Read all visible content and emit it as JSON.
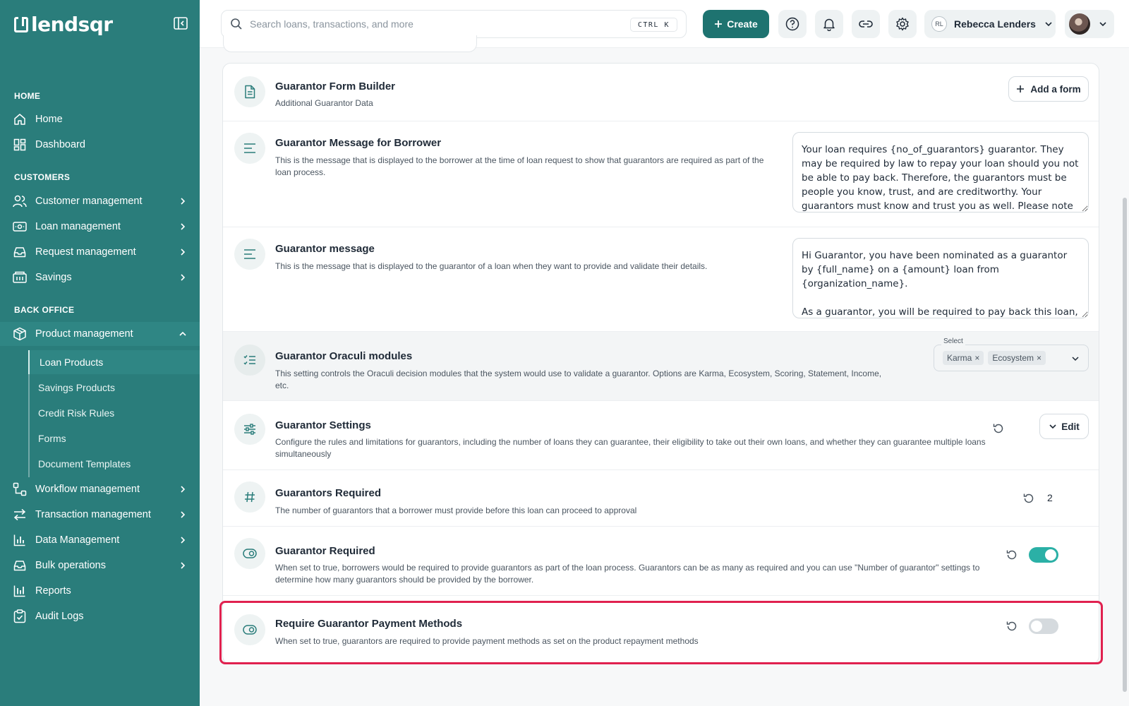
{
  "brand": {
    "name": "lendsqr"
  },
  "sidebar": {
    "sections": {
      "home": "HOME",
      "customers": "CUSTOMERS",
      "back_office": "BACK OFFICE"
    },
    "items": {
      "home": "Home",
      "dashboard": "Dashboard",
      "customer_management": "Customer management",
      "loan_management": "Loan management",
      "request_management": "Request management",
      "savings": "Savings",
      "product_management": "Product management",
      "workflow_management": "Workflow management",
      "transaction_management": "Transaction management",
      "data_management": "Data Management",
      "bulk_operations": "Bulk operations",
      "reports": "Reports",
      "audit_logs": "Audit Logs"
    },
    "sub_items": {
      "loan_products": "Loan Products",
      "savings_products": "Savings Products",
      "credit_risk_rules": "Credit Risk Rules",
      "forms": "Forms",
      "document_templates": "Document Templates"
    }
  },
  "topbar": {
    "search_placeholder": "Search loans, transactions, and more",
    "shortcut": "CTRL K",
    "create_label": "Create",
    "org_initials": "RL",
    "org_name": "Rebecca Lenders"
  },
  "settings": {
    "form_builder": {
      "title": "Guarantor Form Builder",
      "desc": "Additional Guarantor Data",
      "button": "Add a form"
    },
    "borrower_message": {
      "title": "Guarantor Message for Borrower",
      "desc": "This is the message that is displayed to the borrower at the time of loan request to show that guarantors are required as part of the loan process.",
      "value": "Your loan requires {no_of_guarantors} guarantor. They may be required by law to repay your loan should you not be able to pay back. Therefore, the guarantors must be people you know, trust, and are creditworthy. Your guarantors must know and trust you as well. Please note that your guarantors"
    },
    "guarantor_message": {
      "title": "Guarantor message",
      "desc": "This is the message that is displayed to the guarantor of a loan when they want to provide and validate their details.",
      "value": "Hi Guarantor, you have been nominated as a guarantor by {full_name} on a {amount} loan from {organization_name}.\n\nAs a guarantor, you will be required to pay back this loan, inclusive of fees, interest, or charges, should {first_name}"
    },
    "oraculi": {
      "title": "Guarantor Oraculi modules",
      "desc": "This setting controls the Oraculi decision modules that the system would use to validate a guarantor. Options are Karma, Ecosystem, Scoring, Statement, Income, etc.",
      "select_label": "Select",
      "chips": [
        "Karma",
        "Ecosystem"
      ]
    },
    "guarantor_settings": {
      "title": "Guarantor Settings",
      "desc": "Configure the rules and limitations for guarantors, including the number of loans they can guarantee, their eligibility to take out their own loans, and whether they can guarantee multiple loans simultaneously",
      "button": "Edit"
    },
    "guarantors_required": {
      "title": "Guarantors Required",
      "desc": "The number of guarantors that a borrower must provide before this loan can proceed to approval",
      "value": "2"
    },
    "guarantor_required": {
      "title": "Guarantor Required",
      "desc": "When set to true, borrowers would be required to provide guarantors as part of the loan process. Guarantors can be as many as required and you can use \"Number of guarantor\" settings to determine how many guarantors should be provided by the borrower.",
      "enabled": true
    },
    "payment_methods": {
      "title": "Require Guarantor Payment Methods",
      "desc": "When set to true, guarantors are required to provide payment methods as set on the product repayment methods",
      "enabled": false
    }
  },
  "colors": {
    "sidebar": "#2a7d7b",
    "accent": "#1e7370",
    "toggle_on": "#2bb0a6",
    "highlight": "#e0214f"
  }
}
